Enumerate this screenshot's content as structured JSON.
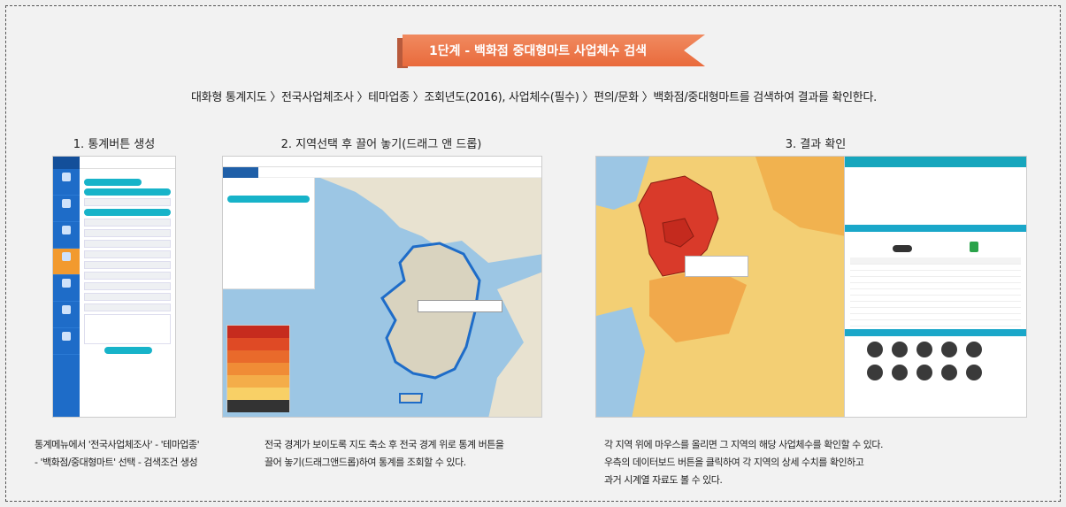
{
  "banner": {
    "title": "1단계 - 백화점 중대형마트 사업체수 검색"
  },
  "intro": {
    "text": "대화형 통계지도 〉전국사업체조사 〉테마업종 〉조회년도(2016), 사업체수(필수) 〉편의/문화 〉백화점/중대형마트를 검색하여 결과를 확인한다."
  },
  "steps": [
    {
      "title": "1. 통계버튼 생성",
      "caption_lines": [
        "통계메뉴에서 '전국사업체조사' - '테마업종'",
        "- '백화점/중대형마트' 선택 - 검색조건 생성"
      ]
    },
    {
      "title": "2. 지역선택 후 끌어 놓기(드래그 앤 드롭)",
      "caption_lines": [
        "전국 경계가 보이도록 지도 축소 후 전국 경계 위로 통계 버튼을",
        "끌어 놓기(드래그앤드롭)하여 통계를 조회할 수 있다."
      ]
    },
    {
      "title": "3. 결과 확인",
      "caption_lines": [
        "각 지역 위에 마우스를 올리면 그 지역의 해당 사업체수를 확인할 수 있다.",
        "우측의 데이터보드 버튼을 클릭하여 각 지역의 상세 수치를 확인하고",
        "과거 시계열 자료도 볼 수 있다."
      ]
    }
  ],
  "colors": {
    "banner": "#ea6f42",
    "menu_blue": "#1e6cc8",
    "accent_cyan": "#17b3c9",
    "map_sea": "#9cc6e4",
    "map_high": "#d93a2a",
    "map_mid": "#f1a94b",
    "map_low": "#f7d37a"
  }
}
